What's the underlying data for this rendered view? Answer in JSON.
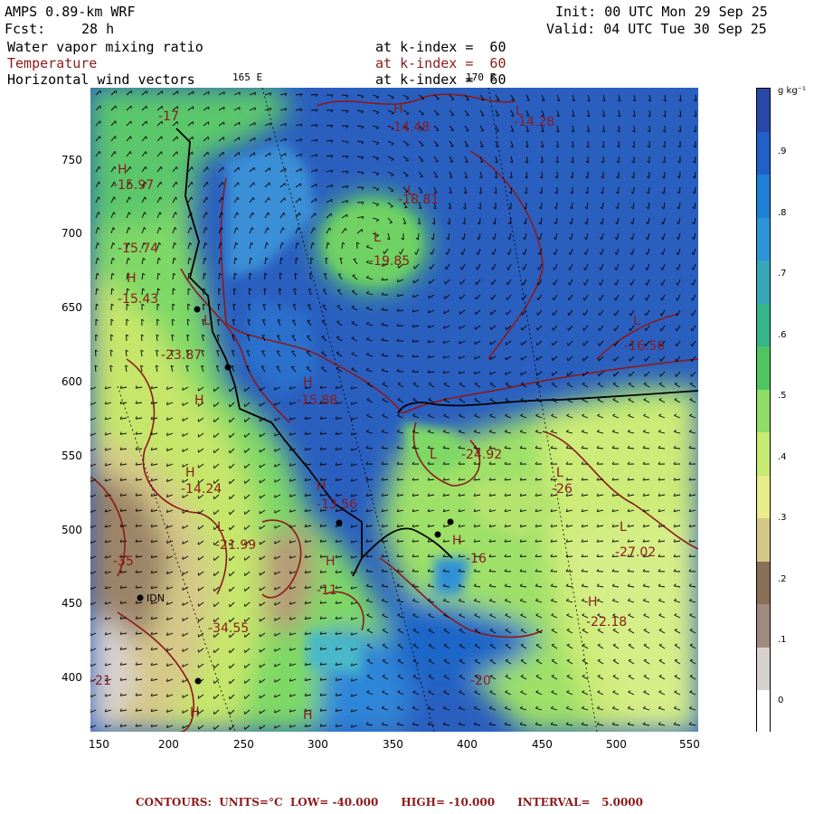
{
  "header": {
    "model": "AMPS 0.89-km WRF",
    "init": "Init: 00 UTC Mon 29 Sep 25",
    "fcst_label": "Fcst:",
    "fcst_value": "28 h",
    "valid": "Valid: 04 UTC Tue 30 Sep 25"
  },
  "fields": [
    {
      "name": "Water vapor mixing ratio",
      "level": "at k-index =  60",
      "color": "#000000"
    },
    {
      "name": "Temperature",
      "level": "at k-index =  60",
      "color": "#8b1a1a"
    },
    {
      "name": "Horizontal wind vectors",
      "level": "at k-index =  60",
      "color": "#000000"
    }
  ],
  "meridians": [
    {
      "label": "165 E"
    },
    {
      "label": "170 E"
    }
  ],
  "axes": {
    "x_ticks": [
      "150",
      "200",
      "250",
      "300",
      "350",
      "400",
      "450",
      "500",
      "550"
    ],
    "y_ticks": [
      "400",
      "450",
      "500",
      "550",
      "600",
      "650",
      "700",
      "750"
    ],
    "x_range": [
      145,
      552
    ],
    "y_range": [
      363,
      795
    ]
  },
  "colorbar": {
    "units": "g kg⁻¹",
    "levels": [
      "0",
      ".1",
      ".2",
      ".3",
      ".4",
      ".5",
      ".6",
      ".7",
      ".8",
      ".9"
    ],
    "colors": [
      "#ffffff",
      "#d9d1cf",
      "#a08a80",
      "#8a6e55",
      "#d6c888",
      "#e8ec8a",
      "#c8ea70",
      "#8fdc66",
      "#50c460",
      "#35b58a",
      "#35a8b8",
      "#2a96d8",
      "#1e7fd8",
      "#2060c8",
      "#2748a8"
    ]
  },
  "stations": [
    {
      "label": "IDN"
    }
  ],
  "temperature_labels": [
    "-15.97",
    "-15.74",
    "-15.43",
    "-23.87",
    "-14.24",
    "-21.99",
    "-35",
    "-21",
    "-34.55",
    "-18.81",
    "-19.85",
    "-14.48",
    "-14.28",
    "-15.88",
    "-16.56",
    "-24.92",
    "-13.56",
    "-27.02",
    "-22.18",
    "-26",
    "-20",
    "-11",
    "-17",
    "-16"
  ],
  "high_low_marks": [
    "H",
    "L"
  ],
  "footer": "CONTOURS:  UNITS=°C  LOW= -40.000      HIGH= -10.000      INTERVAL=   5.0000"
}
